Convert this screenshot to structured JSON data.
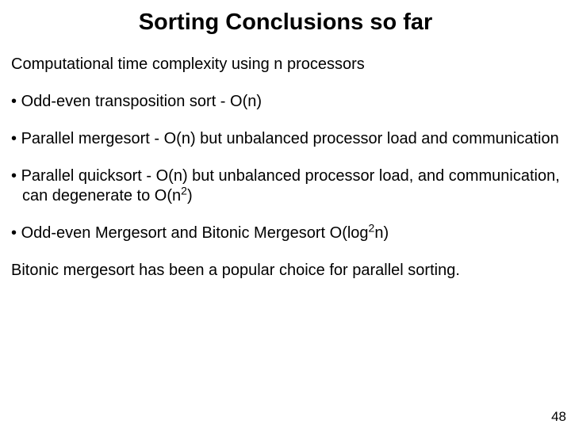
{
  "title": "Sorting Conclusions so far",
  "intro": "Computational time complexity using n processors",
  "bullets": {
    "b1": "Odd-even transposition sort - O(n)",
    "b2": "Parallel mergesort - O(n) but unbalanced processor load and communication",
    "b3_pre": "Parallel quicksort - O(n) but unbalanced processor load, and communication, can degenerate to O(n",
    "b3_sup": "2",
    "b3_post": ")",
    "b4_pre": "Odd-even Mergesort and Bitonic Mergesort O(log",
    "b4_sup": "2",
    "b4_post": "n)"
  },
  "closing": "Bitonic mergesort has been a popular choice for parallel sorting.",
  "page_number": "48"
}
